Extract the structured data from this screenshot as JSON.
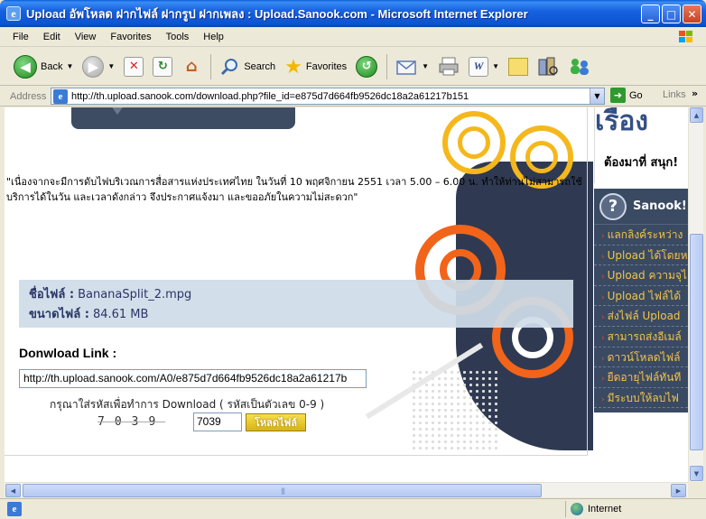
{
  "window": {
    "title": "Upload อัพโหลด ฝากไฟล์ ฝากรูป ฝากเพลง : Upload.Sanook.com - Microsoft Internet Explorer"
  },
  "menu": [
    "File",
    "Edit",
    "View",
    "Favorites",
    "Tools",
    "Help"
  ],
  "toolbar": {
    "back_label": "Back",
    "search_label": "Search",
    "favorites_label": "Favorites"
  },
  "address": {
    "label": "Address",
    "url": "http://th.upload.sanook.com/download.php?file_id=e875d7d664fb9526dc18a2a61217b151",
    "go_label": "Go",
    "links_label": "Links"
  },
  "page": {
    "notice": "\"เนื่องจากจะมีการดับไฟบริเวณการสื่อสารแห่งประเทศไทย ในวันที่ 10 พฤศจิกายน 2551 เวลา 5.00 – 6.00 น. ทำให้ท่านไม่สามารถใช้บริการได้ในวัน และเวลาดังกล่าว จึงประกาศแจ้งมา และขออภัยในความไม่สะดวก\"",
    "file": {
      "name_label": "ชื่อไฟล์ :",
      "name_value": "BananaSplit_2.mpg",
      "size_label": "ขนาดไฟล์ :",
      "size_value": "84.61 MB"
    },
    "download": {
      "title": "Donwload Link :",
      "link": "http://th.upload.sanook.com/A0/e875d7d664fb9526dc18a2a61217b",
      "captcha_prompt": "กรุณาใส่รหัสเพื่อทำการ Download ( รหัสเป็นตัวเลข 0-9 )",
      "captcha_code": "7039",
      "captcha_input": "7039",
      "button_label": "โหลดไฟล์"
    }
  },
  "sidebar": {
    "top_text": "เรือง",
    "top_tagline": "ต้องมาที่ สนุก!",
    "panel_title": "Sanook!",
    "items": [
      "แลกลิงค์ระหว่าง",
      "Upload ได้โดยห",
      "Upload ความจุไ",
      "Upload ไฟล์ได้",
      "ส่งไฟล์ Upload",
      "สามารถส่งอีเมล์",
      "ดาวน์โหลดไฟล์",
      "ยืดอายุไฟล์ทันที",
      "มีระบบให้ลบไฟ"
    ]
  },
  "status": {
    "zone": "Internet"
  },
  "colors": {
    "titlebar": "#0d53d1",
    "sidebar_panel": "#3a4a63",
    "sidebar_link": "#f2c44a",
    "art_orange": "#f2641a",
    "art_yellow": "#f5b81c",
    "button_yellow": "#e8c42a"
  }
}
